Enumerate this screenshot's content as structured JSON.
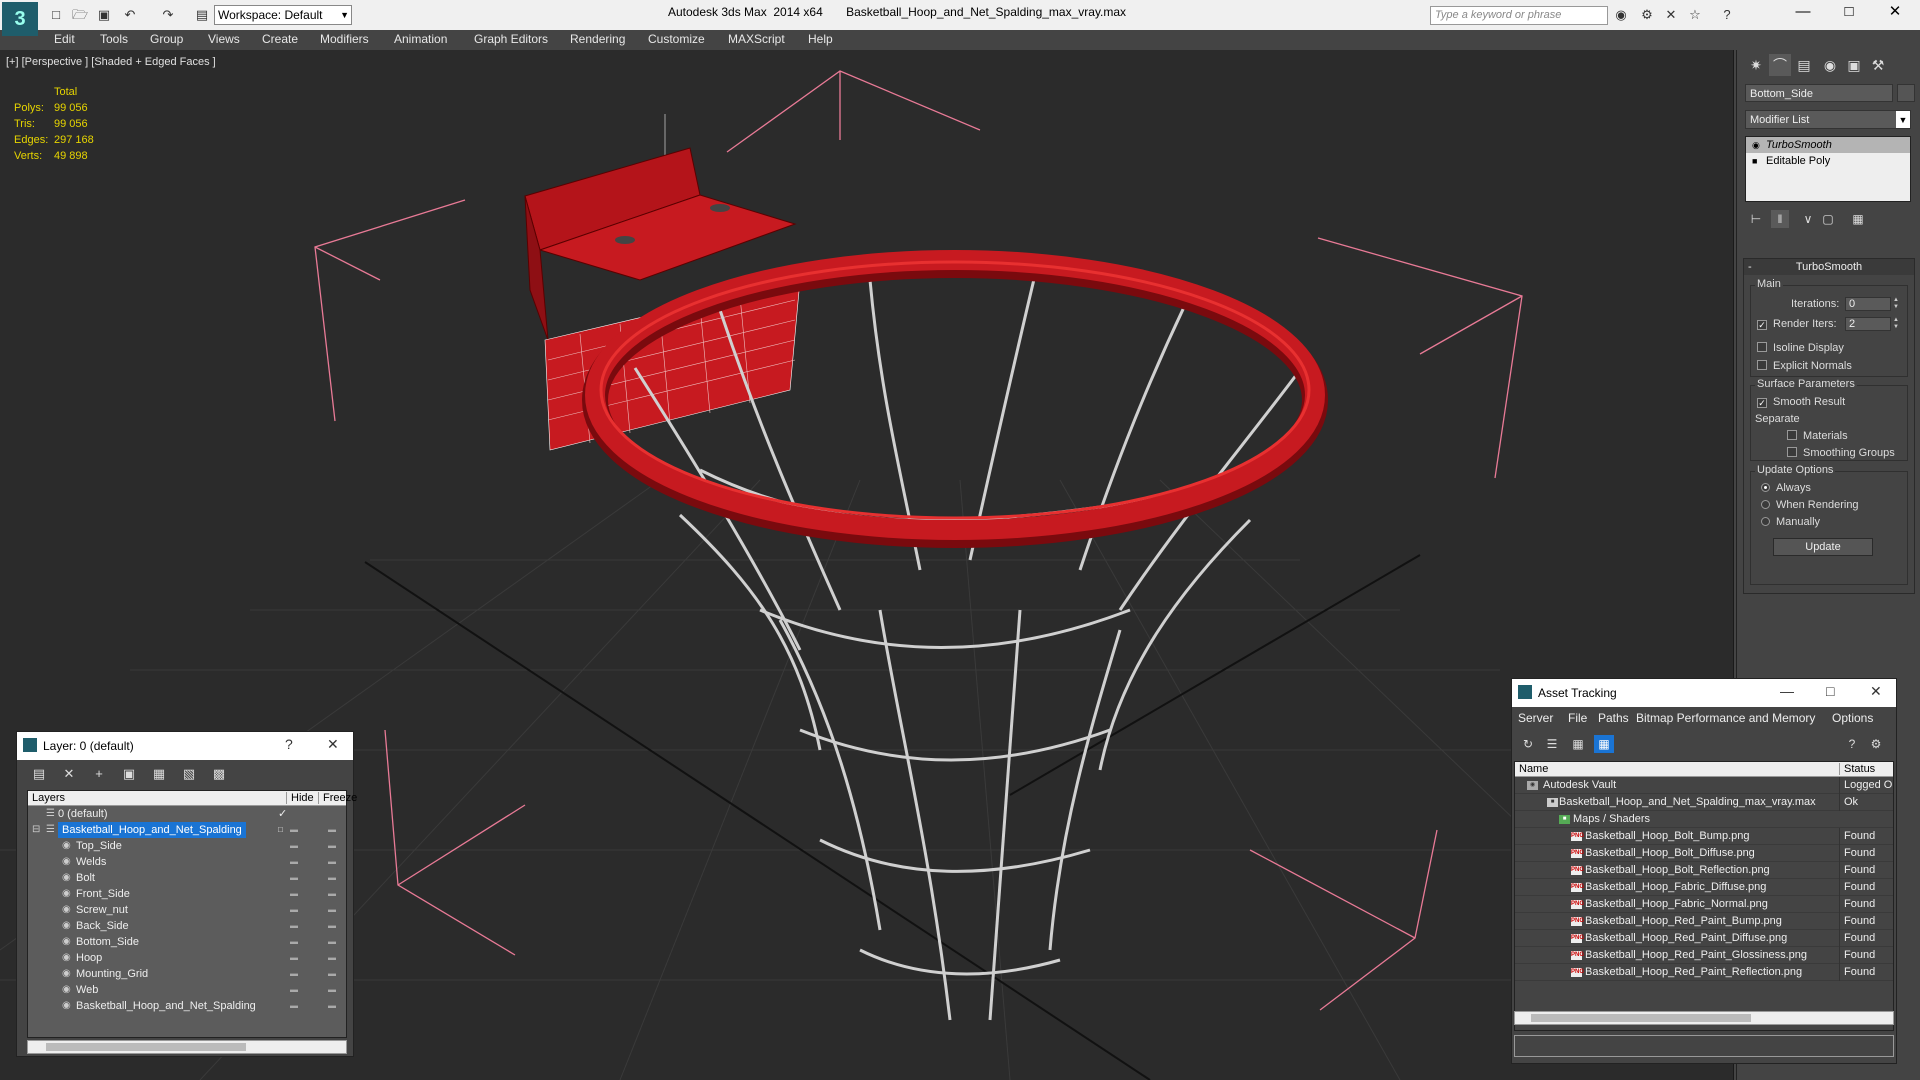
{
  "titlebar": {
    "workspace": "Workspace: Default",
    "title": "Autodesk 3ds Max  2014 x64       Basketball_Hoop_and_Net_Spalding_max_vray.max",
    "search_placeholder": "Type a keyword or phrase"
  },
  "menu": [
    "Edit",
    "Tools",
    "Group",
    "Views",
    "Create",
    "Modifiers",
    "Animation",
    "Graph Editors",
    "Rendering",
    "Customize",
    "MAXScript",
    "Help"
  ],
  "viewport": {
    "label": "[+] [Perspective ] [Shaded + Edged Faces ]",
    "stats": {
      "header": "Total",
      "rows": [
        {
          "label": "Polys:",
          "value": "99 056"
        },
        {
          "label": "Tris:",
          "value": "99 056"
        },
        {
          "label": "Edges:",
          "value": "297 168"
        },
        {
          "label": "Verts:",
          "value": "49 898"
        }
      ]
    }
  },
  "command_panel": {
    "object_name": "Bottom_Side",
    "modifier_list": "Modifier List",
    "stack": [
      "TurboSmooth",
      "Editable Poly"
    ],
    "turbosmooth": {
      "title": "TurboSmooth",
      "main_label": "Main",
      "iterations_label": "Iterations:",
      "iterations_value": "0",
      "render_iters_label": "Render Iters:",
      "render_iters_value": "2",
      "isoline_display": "Isoline Display",
      "explicit_normals": "Explicit Normals",
      "surface_params": "Surface Parameters",
      "smooth_result": "Smooth Result",
      "separate": "Separate",
      "materials": "Materials",
      "smoothing_groups": "Smoothing Groups",
      "update_options": "Update Options",
      "always": "Always",
      "when_rendering": "When Rendering",
      "manually": "Manually",
      "update_button": "Update"
    }
  },
  "layer_dialog": {
    "title": "Layer: 0 (default)",
    "col_layers": "Layers",
    "col_hide": "Hide",
    "col_freeze": "Freeze",
    "default_layer": "0 (default)",
    "selected_layer": "Basketball_Hoop_and_Net_Spalding",
    "objects": [
      "Top_Side",
      "Welds",
      "Bolt",
      "Front_Side",
      "Screw_nut",
      "Back_Side",
      "Bottom_Side",
      "Hoop",
      "Mounting_Grid",
      "Web",
      "Basketball_Hoop_and_Net_Spalding"
    ]
  },
  "asset_tracking": {
    "title": "Asset Tracking",
    "menu": [
      "Server",
      "File",
      "Paths",
      "Bitmap Performance and Memory",
      "Options"
    ],
    "col_name": "Name",
    "col_status": "Status",
    "rows": [
      {
        "name": "Autodesk Vault",
        "status": "Logged O",
        "indent": 1,
        "icon": "vault"
      },
      {
        "name": "Basketball_Hoop_and_Net_Spalding_max_vray.max",
        "status": "Ok",
        "indent": 2,
        "icon": "max"
      },
      {
        "name": "Maps / Shaders",
        "status": "",
        "indent": 3,
        "icon": "folder"
      },
      {
        "name": "Basketball_Hoop_Bolt_Bump.png",
        "status": "Found",
        "indent": 4,
        "icon": "png"
      },
      {
        "name": "Basketball_Hoop_Bolt_Diffuse.png",
        "status": "Found",
        "indent": 4,
        "icon": "png"
      },
      {
        "name": "Basketball_Hoop_Bolt_Reflection.png",
        "status": "Found",
        "indent": 4,
        "icon": "png"
      },
      {
        "name": "Basketball_Hoop_Fabric_Diffuse.png",
        "status": "Found",
        "indent": 4,
        "icon": "png"
      },
      {
        "name": "Basketball_Hoop_Fabric_Normal.png",
        "status": "Found",
        "indent": 4,
        "icon": "png"
      },
      {
        "name": "Basketball_Hoop_Red_Paint_Bump.png",
        "status": "Found",
        "indent": 4,
        "icon": "png"
      },
      {
        "name": "Basketball_Hoop_Red_Paint_Diffuse.png",
        "status": "Found",
        "indent": 4,
        "icon": "png"
      },
      {
        "name": "Basketball_Hoop_Red_Paint_Glossiness.png",
        "status": "Found",
        "indent": 4,
        "icon": "png"
      },
      {
        "name": "Basketball_Hoop_Red_Paint_Reflection.png",
        "status": "Found",
        "indent": 4,
        "icon": "png"
      }
    ]
  },
  "colors": {
    "viewport_bg": "#2b2b2b",
    "stats_text": "#e6d400",
    "selection": "#1a74d4",
    "hoop_red": "#c0141a",
    "bbox_pink": "#e87a96"
  }
}
